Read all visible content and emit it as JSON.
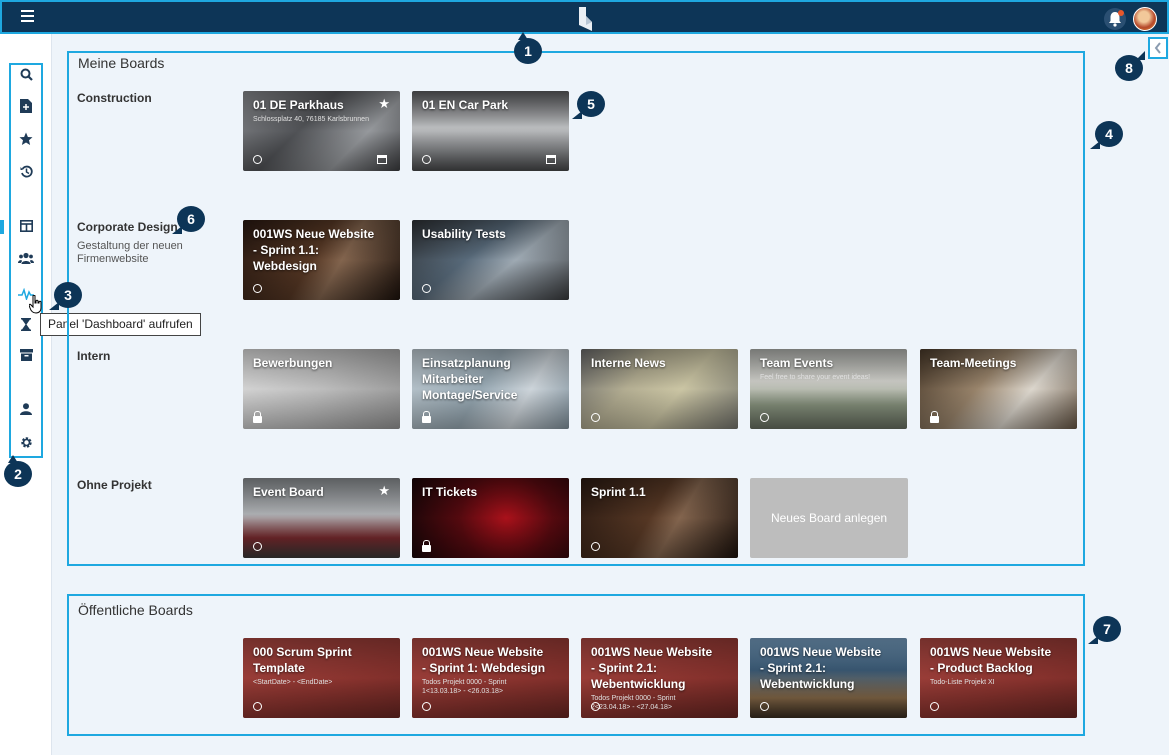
{
  "tooltip": "Panel 'Dashboard' aufrufen",
  "callouts": [
    "1",
    "2",
    "3",
    "4",
    "5",
    "6",
    "7",
    "8"
  ],
  "sidebar": {
    "icons": [
      "search-icon",
      "new-file-icon",
      "star-icon",
      "history-icon",
      "board-icon",
      "team-icon",
      "dashboard-icon",
      "hourglass-icon",
      "archive-icon",
      "user-icon",
      "settings-icon"
    ]
  },
  "my_boards": {
    "title": "Meine Boards",
    "groups": [
      {
        "name": "Construction",
        "description": ""
      },
      {
        "name": "Corporate Design",
        "description": "Gestaltung der neuen Firmenwebsite"
      },
      {
        "name": "Intern",
        "description": ""
      },
      {
        "name": "Ohne Projekt",
        "description": ""
      }
    ],
    "boards": [
      {
        "title": "01 DE Parkhaus",
        "subtitle": "Schlossplatz 40, 76185 Karlsbrunnen",
        "visibility": "public",
        "starred": true,
        "calendar": true
      },
      {
        "title": "01 EN Car Park",
        "subtitle": "",
        "visibility": "public",
        "starred": false,
        "calendar": true
      },
      {
        "title": "001WS Neue Website - Sprint 1.1: Webdesign",
        "subtitle": "",
        "visibility": "public"
      },
      {
        "title": "Usability Tests",
        "subtitle": "",
        "visibility": "public"
      },
      {
        "title": "Bewerbungen",
        "subtitle": "",
        "visibility": "private"
      },
      {
        "title": "Einsatzplanung Mitarbeiter Montage/Service",
        "subtitle": "",
        "visibility": "private"
      },
      {
        "title": "Interne News",
        "subtitle": "",
        "visibility": "public"
      },
      {
        "title": "Team Events",
        "subtitle": "Feel free to share your event ideas!",
        "visibility": "public"
      },
      {
        "title": "Team-Meetings",
        "subtitle": "",
        "visibility": "private"
      },
      {
        "title": "Event Board",
        "subtitle": "",
        "visibility": "public",
        "starred": true
      },
      {
        "title": "IT Tickets",
        "subtitle": "",
        "visibility": "private"
      },
      {
        "title": "Sprint 1.1",
        "subtitle": "",
        "visibility": "public"
      }
    ],
    "new_board_label": "Neues Board anlegen"
  },
  "public_boards": {
    "title": "Öffentliche Boards",
    "boards": [
      {
        "title": "000 Scrum Sprint Template",
        "subtitle": "<StartDate> - <EndDate>",
        "visibility": "public"
      },
      {
        "title": "001WS Neue Website - Sprint 1: Webdesign",
        "subtitle": "Todos Projekt 0000 - Sprint 1<13.03.18> - <26.03.18>",
        "visibility": "public"
      },
      {
        "title": "001WS Neue Website - Sprint 2.1: Webentwicklung",
        "subtitle": "Todos Projekt 0000 - Sprint 2<23.04.18> - <27.04.18>",
        "visibility": "public"
      },
      {
        "title": "001WS Neue Website - Sprint 2.1: Webentwicklung",
        "subtitle": "",
        "visibility": "public"
      },
      {
        "title": "001WS Neue Website - Product Backlog",
        "subtitle": "Todo-Liste Projekt XI",
        "visibility": "public"
      }
    ]
  }
}
